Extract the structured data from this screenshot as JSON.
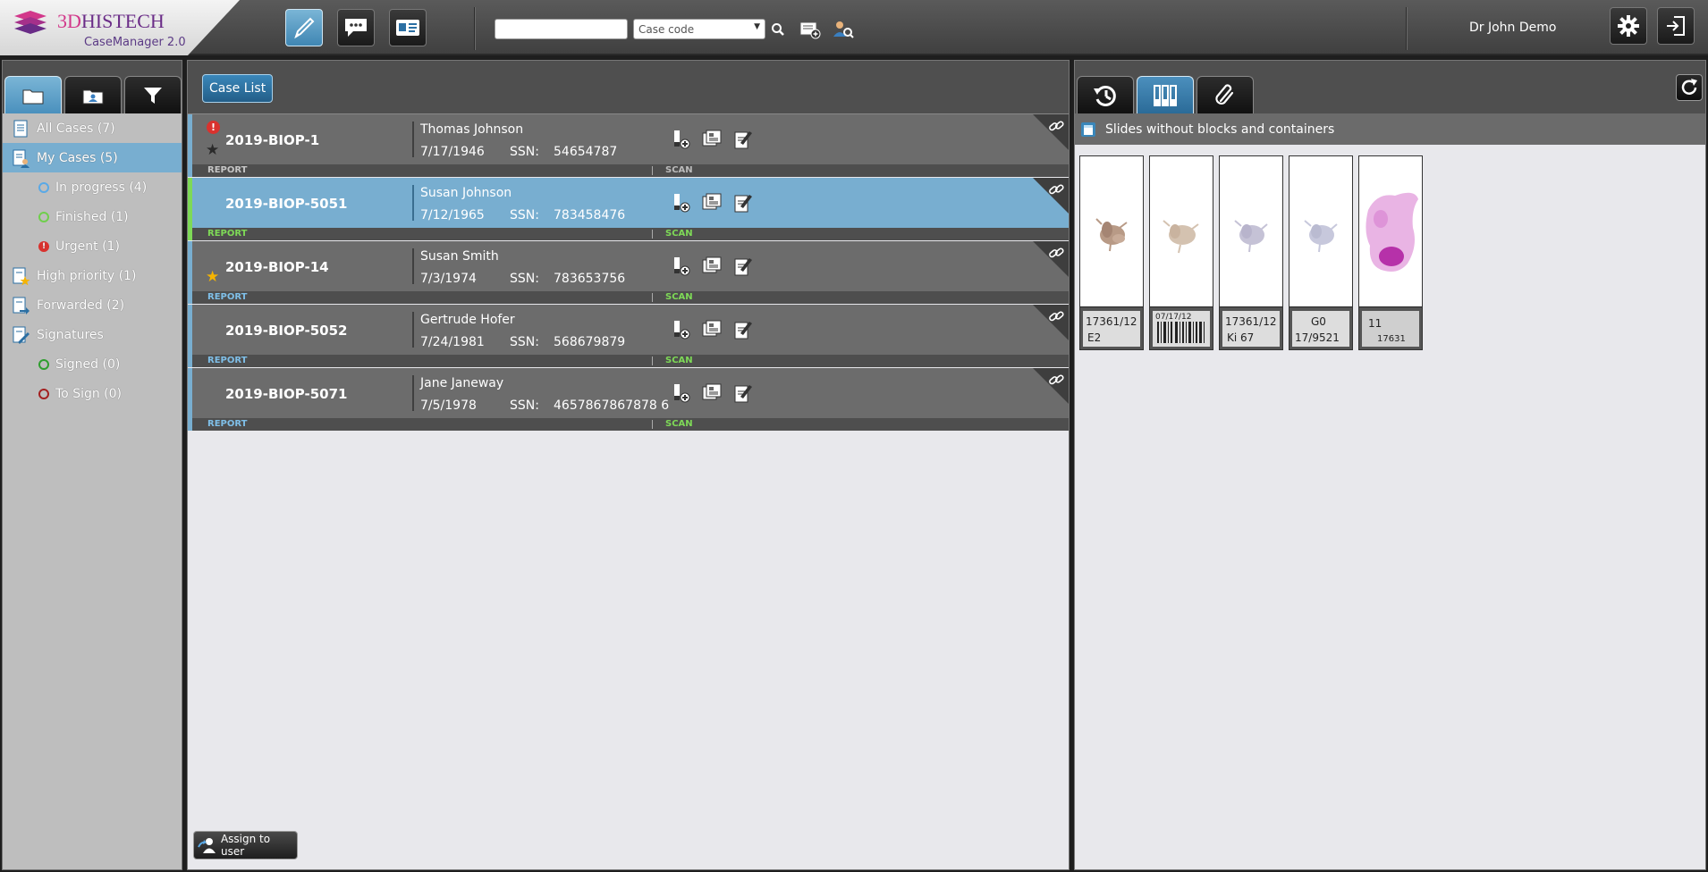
{
  "header": {
    "brand_part1": "3D",
    "brand_part2": "HISTECH",
    "product": "CaseManager 2.0",
    "search_value": "",
    "case_code_select": "Case code",
    "user": "Dr John Demo"
  },
  "sidebar": {
    "items": [
      {
        "label": "All Cases (7)",
        "icon": "all-cases-icon",
        "level": "top"
      },
      {
        "label": "My Cases (5)",
        "icon": "my-cases-icon",
        "level": "top",
        "active": true
      },
      {
        "label": "In progress (4)",
        "status_color": "#5aa9e6",
        "level": "sub"
      },
      {
        "label": "Finished (1)",
        "status_color": "#6fcf4c",
        "level": "sub"
      },
      {
        "label": "Urgent (1)",
        "status_color": "#d9322e",
        "level": "sub"
      },
      {
        "label": "High priority (1)",
        "icon": "high-priority-icon",
        "level": "top"
      },
      {
        "label": "Forwarded (2)",
        "icon": "forwarded-icon",
        "level": "top"
      },
      {
        "label": "Signatures",
        "icon": "signatures-icon",
        "level": "top"
      },
      {
        "label": "Signed (0)",
        "status_color": "#2f9e2f",
        "level": "sub"
      },
      {
        "label": "To Sign (0)",
        "status_color": "#a32020",
        "level": "sub"
      }
    ]
  },
  "center": {
    "case_list_label": "Case List",
    "assign_label": "Assign to user",
    "ssn_label": "SSN:",
    "report_label": "REPORT",
    "scan_label": "SCAN",
    "cases": [
      {
        "id": "2019-BIOP-1",
        "name": "Thomas Johnson",
        "dob": "7/17/1946",
        "ssn": "54654787",
        "urgent": true,
        "star": "dark",
        "report_state": "grey",
        "scan_state": "grey"
      },
      {
        "id": "2019-BIOP-5051",
        "name": "Susan Johnson",
        "dob": "7/12/1965",
        "ssn": "783458476",
        "selected": true,
        "report_state": "green",
        "scan_state": "green"
      },
      {
        "id": "2019-BIOP-14",
        "name": "Susan Smith",
        "dob": "7/3/1974",
        "ssn": "783653756",
        "star": "gold",
        "report_state": "blue",
        "scan_state": "green"
      },
      {
        "id": "2019-BIOP-5052",
        "name": "Gertrude Hofer",
        "dob": "7/24/1981",
        "ssn": "568679879",
        "report_state": "blue",
        "scan_state": "green"
      },
      {
        "id": "2019-BIOP-5071",
        "name": "Jane Janeway",
        "dob": "7/5/1978",
        "ssn": "4657867867878 6",
        "report_state": "blue",
        "scan_state": "green"
      }
    ]
  },
  "right": {
    "slides_header": "Slides without blocks and containers",
    "slides": [
      {
        "label_text": "17361/12 E2",
        "tissue_color": "#b89a86"
      },
      {
        "label_text": "barcode",
        "tissue_color": "#d4c2b0"
      },
      {
        "label_text": "17361/12 Ki 67",
        "tissue_color": "#c5c2d6"
      },
      {
        "label_text": "G0 17/9521",
        "tissue_color": "#c7c8dc"
      },
      {
        "label_text": "11 17631",
        "tissue_color": "#c545b8"
      }
    ]
  }
}
